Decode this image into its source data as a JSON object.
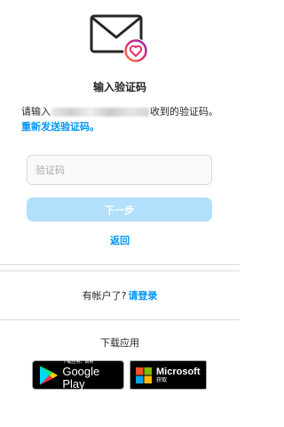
{
  "header": {
    "title": "输入验证码"
  },
  "message": {
    "prefix": "请输入",
    "suffix": "收到的验证码。",
    "resend_link": "重新发送验证码。"
  },
  "form": {
    "code_placeholder": "验证码",
    "next_label": "下一步",
    "back_label": "返回"
  },
  "login": {
    "prompt": "有帐户了?",
    "link": "请登录"
  },
  "download": {
    "title": "下载应用",
    "google_small": "下载应用，请到",
    "google_big": "Google Play",
    "ms_big": "Microsoft",
    "ms_small": "获取"
  },
  "colors": {
    "accent": "#0095f6",
    "button_disabled": "#b2dffc",
    "border": "#dbdbdb",
    "heart": "#e1306c"
  }
}
